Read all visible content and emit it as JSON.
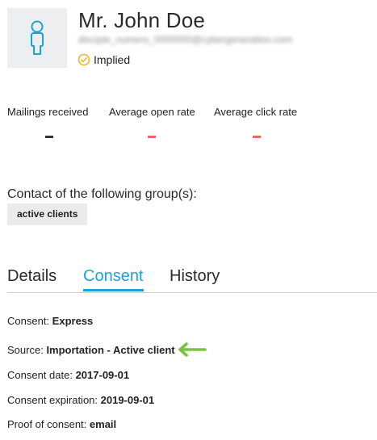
{
  "contact": {
    "name": "Mr. John Doe",
    "email": "disciple_numero_0000000@cybergeneration.com",
    "status_label": "Implied",
    "avatar_icon": "person-icon"
  },
  "stats": [
    {
      "label": "Mailings received",
      "value": "-",
      "color": "#333333"
    },
    {
      "label": "Average open rate",
      "value": "-",
      "color": "#e66a5e"
    },
    {
      "label": "Average click rate",
      "value": "-",
      "color": "#e66a5e"
    }
  ],
  "groups": {
    "title": "Contact of the following group(s):",
    "items": [
      "active clients"
    ]
  },
  "tabs": [
    {
      "label": "Details",
      "active": false
    },
    {
      "label": "Consent",
      "active": true
    },
    {
      "label": "History",
      "active": false
    }
  ],
  "consent": {
    "type_label": "Consent:",
    "type_value": "Express",
    "source_label": "Source:",
    "source_value": "Importation - Active client",
    "date_label": "Consent date:",
    "date_value": "2017-09-01",
    "expiration_label": "Consent expiration:",
    "expiration_value": "2019-09-01",
    "proof_label": "Proof of consent:",
    "proof_value": "email"
  },
  "colors": {
    "accent": "#1aa3d4",
    "status_check": "#e8b923",
    "arrow": "#7cc142",
    "rate_dash": "#e66a5e"
  }
}
